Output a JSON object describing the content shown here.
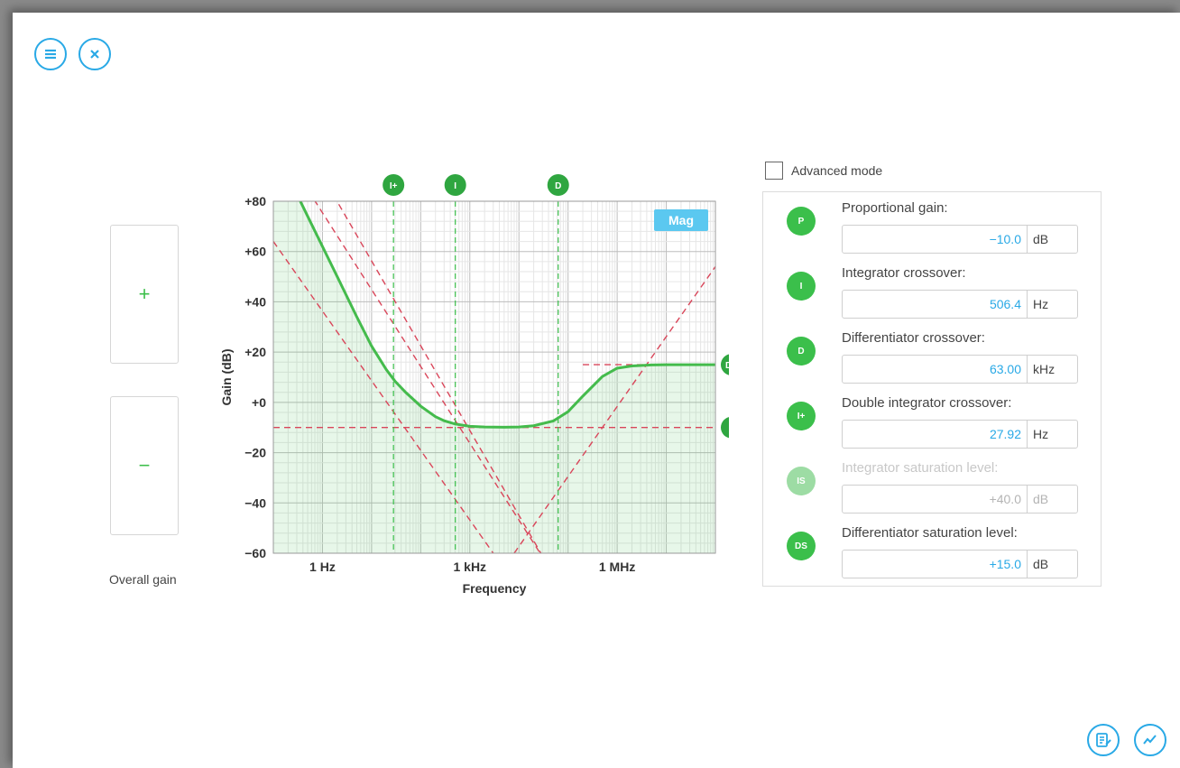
{
  "toolbar": {
    "menu_icon": "hamburger-icon",
    "close_icon": "close-icon"
  },
  "overall_gain": {
    "plus_label": "+",
    "minus_label": "−",
    "label": "Overall gain"
  },
  "advanced_mode": {
    "label": "Advanced mode",
    "checked": false
  },
  "params": [
    {
      "badge": "P",
      "label": "Proportional gain:",
      "value": "−10.0",
      "unit": "dB",
      "enabled": true
    },
    {
      "badge": "I",
      "label": "Integrator crossover:",
      "value": "506.4",
      "unit": "Hz",
      "enabled": true
    },
    {
      "badge": "D",
      "label": "Differentiator crossover:",
      "value": "63.00",
      "unit": "kHz",
      "enabled": true
    },
    {
      "badge": "I+",
      "label": "Double integrator crossover:",
      "value": "27.92",
      "unit": "Hz",
      "enabled": true
    },
    {
      "badge": "IS",
      "label": "Integrator saturation level:",
      "value": "+40.0",
      "unit": "dB",
      "enabled": false
    },
    {
      "badge": "DS",
      "label": "Differentiator saturation level:",
      "value": "+15.0",
      "unit": "dB",
      "enabled": true
    }
  ],
  "bottom_icons": {
    "report_icon": "report-edit-icon",
    "chart_icon": "trend-chart-icon"
  },
  "colors": {
    "accent": "#29a9e6",
    "green": "#3bbf4b",
    "curve": "#44bb4c",
    "asymptote": "#d9465a",
    "mag_button": "#5bc8f0"
  },
  "chart_data": {
    "type": "line",
    "xlabel": "Frequency",
    "ylabel": "Gain (dB)",
    "x_scale": "log",
    "xlim_hz": [
      0.1,
      100000000
    ],
    "ylim": [
      -60,
      80
    ],
    "x_ticks": [
      {
        "hz": 1,
        "label": "1 Hz"
      },
      {
        "hz": 1000,
        "label": "1 kHz"
      },
      {
        "hz": 1000000,
        "label": "1 MHz"
      }
    ],
    "y_ticks": [
      {
        "value": 80,
        "label": "+80"
      },
      {
        "value": 60,
        "label": "+60"
      },
      {
        "value": 40,
        "label": "+40"
      },
      {
        "value": 20,
        "label": "+20"
      },
      {
        "value": 0,
        "label": "+0"
      },
      {
        "value": -20,
        "label": "−20"
      },
      {
        "value": -40,
        "label": "−40"
      },
      {
        "value": -60,
        "label": "−60"
      }
    ],
    "mode_button": "Mag",
    "proportional_gain_db": -10,
    "integrator_crossover_hz": 506.4,
    "double_integrator_crossover_hz": 27.92,
    "differentiator_crossover_hz": 63000,
    "differentiator_saturation_db": 15,
    "top_markers": [
      {
        "label": "I+",
        "hz": 27.92
      },
      {
        "label": "I",
        "hz": 506.4
      },
      {
        "label": "D",
        "hz": 63000
      }
    ],
    "right_markers": [
      {
        "label": "DS",
        "value": 15
      },
      {
        "label": "P",
        "value": -10
      }
    ],
    "series": [
      {
        "name": "gain",
        "x": [
          0.1,
          0.2,
          0.5,
          1,
          2,
          5,
          10,
          20,
          30,
          50,
          100,
          200,
          300,
          500,
          1000,
          2000,
          5000,
          10000,
          20000,
          50000,
          100000,
          200000,
          500000,
          1000000,
          2000000,
          5000000,
          10000000,
          20000000,
          50000000,
          100000000
        ],
        "y": [
          102,
          90,
          74,
          62,
          50,
          34,
          22.4,
          13,
          8.4,
          3.9,
          -1.5,
          -5.7,
          -7.3,
          -8.6,
          -9.5,
          -9.8,
          -9.9,
          -9.8,
          -9.3,
          -7.4,
          -3.7,
          2.5,
          10.3,
          13.6,
          14.5,
          14.9,
          15,
          15,
          15,
          15
        ]
      }
    ],
    "asymptotes": [
      {
        "x": [
          0.1,
          3000
        ],
        "y": [
          64,
          -60
        ]
      },
      {
        "x": [
          0.1,
          27000
        ],
        "y": [
          106,
          -60
        ]
      },
      {
        "x": [
          8000,
          100000000
        ],
        "y": [
          -60,
          54
        ]
      },
      {
        "x": [
          1,
          28000
        ],
        "y": [
          90,
          -60
        ]
      },
      {
        "x": [
          0.1,
          100000000
        ],
        "y": [
          -10,
          -10
        ]
      },
      {
        "x": [
          200000,
          100000000
        ],
        "y": [
          15,
          15
        ]
      }
    ]
  }
}
